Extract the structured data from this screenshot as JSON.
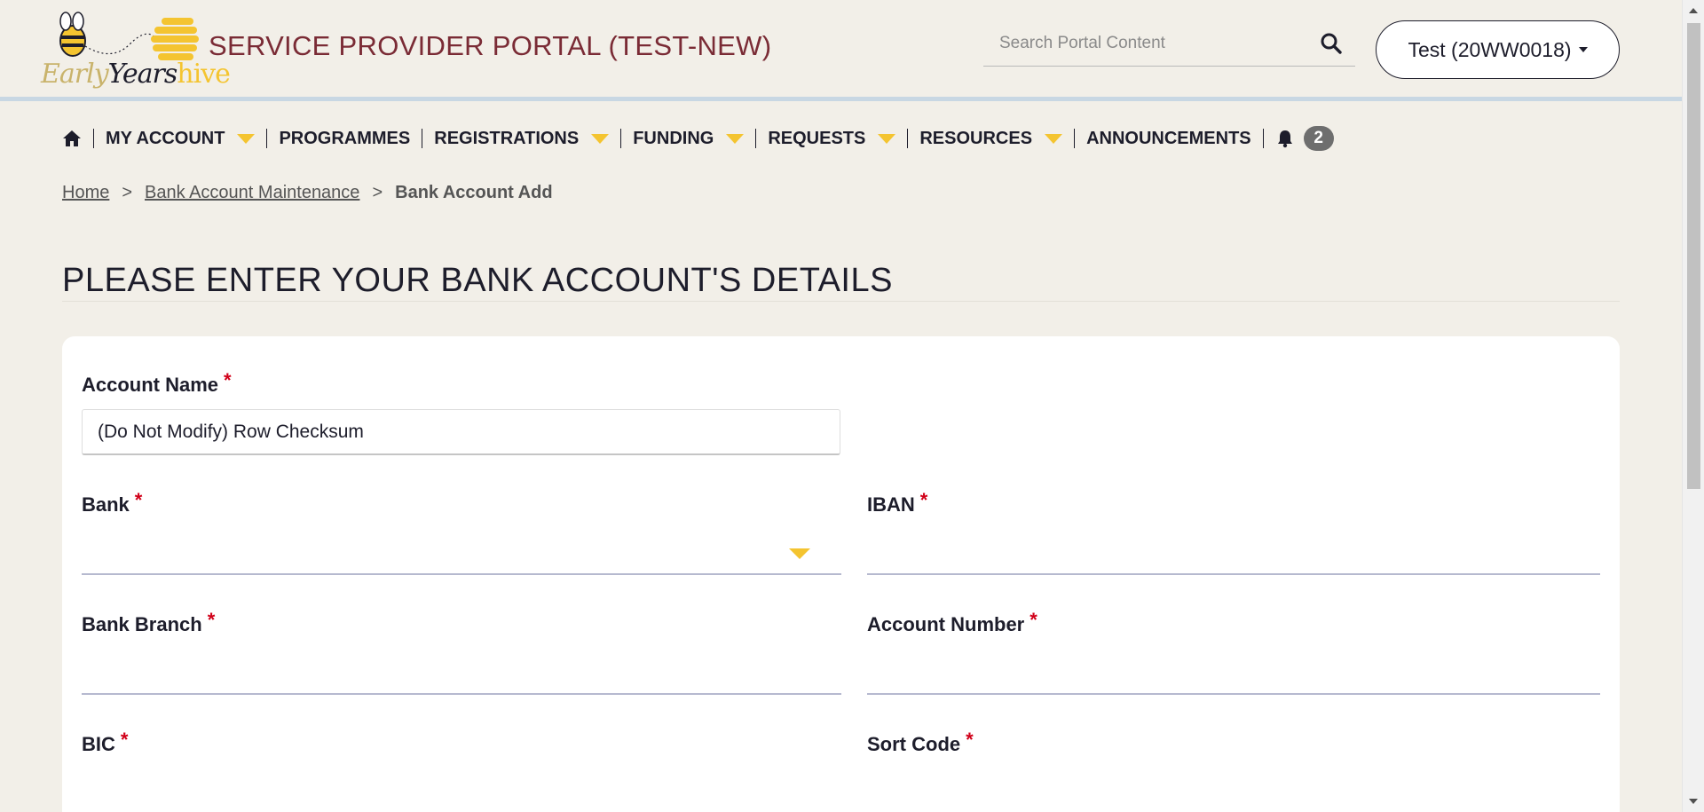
{
  "logo": {
    "early": "Early",
    "years": "Years",
    "hive": "hive"
  },
  "header": {
    "portal_title": "SERVICE PROVIDER PORTAL (TEST-NEW)",
    "search_placeholder": "Search Portal Content",
    "user_label": "Test (20WW0018)"
  },
  "nav": {
    "items": [
      {
        "label": "MY ACCOUNT",
        "dropdown": true
      },
      {
        "label": "PROGRAMMES",
        "dropdown": false
      },
      {
        "label": "REGISTRATIONS",
        "dropdown": true
      },
      {
        "label": "FUNDING",
        "dropdown": true
      },
      {
        "label": "REQUESTS",
        "dropdown": true
      },
      {
        "label": "RESOURCES",
        "dropdown": true
      },
      {
        "label": "ANNOUNCEMENTS",
        "dropdown": false
      }
    ],
    "notification_count": "2"
  },
  "breadcrumb": {
    "home": "Home",
    "sep": ">",
    "maintenance": "Bank Account Maintenance",
    "current": "Bank Account Add"
  },
  "page_title": "PLEASE ENTER YOUR BANK ACCOUNT'S DETAILS",
  "form": {
    "account_name_label": "Account Name",
    "account_name_value": "(Do Not Modify) Row Checksum",
    "bank_label": "Bank",
    "iban_label": "IBAN",
    "bank_branch_label": "Bank Branch",
    "account_number_label": "Account Number",
    "bic_label": "BIC",
    "sort_code_label": "Sort Code",
    "required_mark": "*"
  },
  "colors": {
    "accent_yellow": "#f4c430",
    "title_maroon": "#7a2b35",
    "required_red": "#d10019",
    "background": "#f2efe8"
  }
}
